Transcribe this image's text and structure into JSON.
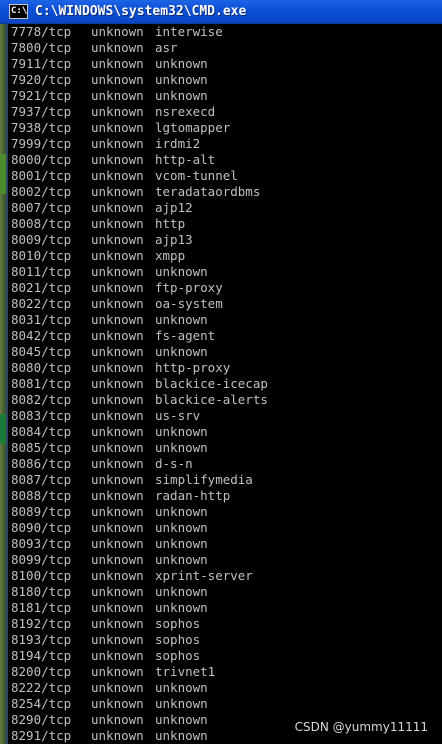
{
  "window": {
    "title": "C:\\WINDOWS\\system32\\CMD.exe",
    "icon_name": "console-app-icon",
    "icon_glyph": "C:\\"
  },
  "colors": {
    "titlebar": "#0b4fd6",
    "console_bg": "#000000",
    "console_text": "#c0c0c0"
  },
  "rows": [
    {
      "port": "7778/tcp",
      "state": "unknown",
      "service": "interwise"
    },
    {
      "port": "7800/tcp",
      "state": "unknown",
      "service": "asr"
    },
    {
      "port": "7911/tcp",
      "state": "unknown",
      "service": "unknown"
    },
    {
      "port": "7920/tcp",
      "state": "unknown",
      "service": "unknown"
    },
    {
      "port": "7921/tcp",
      "state": "unknown",
      "service": "unknown"
    },
    {
      "port": "7937/tcp",
      "state": "unknown",
      "service": "nsrexecd"
    },
    {
      "port": "7938/tcp",
      "state": "unknown",
      "service": "lgtomapper"
    },
    {
      "port": "7999/tcp",
      "state": "unknown",
      "service": "irdmi2"
    },
    {
      "port": "8000/tcp",
      "state": "unknown",
      "service": "http-alt"
    },
    {
      "port": "8001/tcp",
      "state": "unknown",
      "service": "vcom-tunnel"
    },
    {
      "port": "8002/tcp",
      "state": "unknown",
      "service": "teradataordbms"
    },
    {
      "port": "8007/tcp",
      "state": "unknown",
      "service": "ajp12"
    },
    {
      "port": "8008/tcp",
      "state": "unknown",
      "service": "http"
    },
    {
      "port": "8009/tcp",
      "state": "unknown",
      "service": "ajp13"
    },
    {
      "port": "8010/tcp",
      "state": "unknown",
      "service": "xmpp"
    },
    {
      "port": "8011/tcp",
      "state": "unknown",
      "service": "unknown"
    },
    {
      "port": "8021/tcp",
      "state": "unknown",
      "service": "ftp-proxy"
    },
    {
      "port": "8022/tcp",
      "state": "unknown",
      "service": "oa-system"
    },
    {
      "port": "8031/tcp",
      "state": "unknown",
      "service": "unknown"
    },
    {
      "port": "8042/tcp",
      "state": "unknown",
      "service": "fs-agent"
    },
    {
      "port": "8045/tcp",
      "state": "unknown",
      "service": "unknown"
    },
    {
      "port": "8080/tcp",
      "state": "unknown",
      "service": "http-proxy"
    },
    {
      "port": "8081/tcp",
      "state": "unknown",
      "service": "blackice-icecap"
    },
    {
      "port": "8082/tcp",
      "state": "unknown",
      "service": "blackice-alerts"
    },
    {
      "port": "8083/tcp",
      "state": "unknown",
      "service": "us-srv"
    },
    {
      "port": "8084/tcp",
      "state": "unknown",
      "service": "unknown"
    },
    {
      "port": "8085/tcp",
      "state": "unknown",
      "service": "unknown"
    },
    {
      "port": "8086/tcp",
      "state": "unknown",
      "service": "d-s-n"
    },
    {
      "port": "8087/tcp",
      "state": "unknown",
      "service": "simplifymedia"
    },
    {
      "port": "8088/tcp",
      "state": "unknown",
      "service": "radan-http"
    },
    {
      "port": "8089/tcp",
      "state": "unknown",
      "service": "unknown"
    },
    {
      "port": "8090/tcp",
      "state": "unknown",
      "service": "unknown"
    },
    {
      "port": "8093/tcp",
      "state": "unknown",
      "service": "unknown"
    },
    {
      "port": "8099/tcp",
      "state": "unknown",
      "service": "unknown"
    },
    {
      "port": "8100/tcp",
      "state": "unknown",
      "service": "xprint-server"
    },
    {
      "port": "8180/tcp",
      "state": "unknown",
      "service": "unknown"
    },
    {
      "port": "8181/tcp",
      "state": "unknown",
      "service": "unknown"
    },
    {
      "port": "8192/tcp",
      "state": "unknown",
      "service": "sophos"
    },
    {
      "port": "8193/tcp",
      "state": "unknown",
      "service": "sophos"
    },
    {
      "port": "8194/tcp",
      "state": "unknown",
      "service": "sophos"
    },
    {
      "port": "8200/tcp",
      "state": "unknown",
      "service": "trivnet1"
    },
    {
      "port": "8222/tcp",
      "state": "unknown",
      "service": "unknown"
    },
    {
      "port": "8254/tcp",
      "state": "unknown",
      "service": "unknown"
    },
    {
      "port": "8290/tcp",
      "state": "unknown",
      "service": "unknown"
    },
    {
      "port": "8291/tcp",
      "state": "unknown",
      "service": "unknown"
    }
  ],
  "watermark": "CSDN @yummy11111"
}
